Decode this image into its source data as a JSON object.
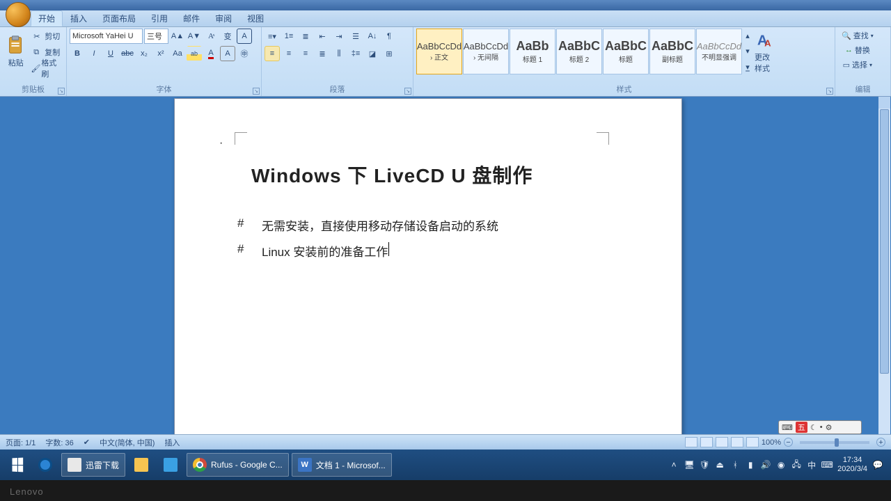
{
  "menu": {
    "tabs": [
      "开始",
      "插入",
      "页面布局",
      "引用",
      "邮件",
      "审阅",
      "视图"
    ],
    "active_index": 0
  },
  "clipboard": {
    "label": "剪贴板",
    "paste": "粘贴",
    "cut": "剪切",
    "copy": "复制",
    "fmt": "格式刷"
  },
  "font": {
    "label": "字体",
    "name": "Microsoft YaHei U",
    "size": "三号"
  },
  "paragraph": {
    "label": "段落"
  },
  "styles": {
    "label": "样式",
    "items": [
      {
        "preview": "AaBbCcDd",
        "name": "› 正文",
        "big": false
      },
      {
        "preview": "AaBbCcDd",
        "name": "› 无间隔",
        "big": false
      },
      {
        "preview": "AaBb",
        "name": "标题 1",
        "big": true
      },
      {
        "preview": "AaBbC",
        "name": "标题 2",
        "big": true
      },
      {
        "preview": "AaBbC",
        "name": "标题",
        "big": true
      },
      {
        "preview": "AaBbC",
        "name": "副标题",
        "big": true
      },
      {
        "preview": "AaBbCcDd",
        "name": "不明显强调",
        "big": false
      }
    ],
    "change": "更改样式"
  },
  "editing": {
    "label": "编辑",
    "find": "查找",
    "replace": "替换",
    "select": "选择"
  },
  "document": {
    "title": "Windows 下 LiveCD   U 盘制作",
    "line1": "无需安装，直接使用移动存储设备启动的系统",
    "line2": "Linux 安装前的准备工作"
  },
  "ime": {
    "badge": "五"
  },
  "statusbar": {
    "page": "页面: 1/1",
    "words": "字数: 36",
    "lang": "中文(简体, 中国)",
    "insert": "插入",
    "zoom": "100%"
  },
  "taskbar": {
    "items": [
      {
        "label": "迅雷下载",
        "icon": "#e8e8e8"
      },
      {
        "label": "",
        "icon": "#f6c451"
      },
      {
        "label": "",
        "icon": "#3aa0e3"
      },
      {
        "label": "Rufus - Google C...",
        "icon": "#d24a3b"
      },
      {
        "label": "文档 1 - Microsof...",
        "icon": "#3b74c4"
      }
    ],
    "ime": "中",
    "time": "17:34",
    "date": "2020/3/4"
  },
  "brand": "Lenovo"
}
